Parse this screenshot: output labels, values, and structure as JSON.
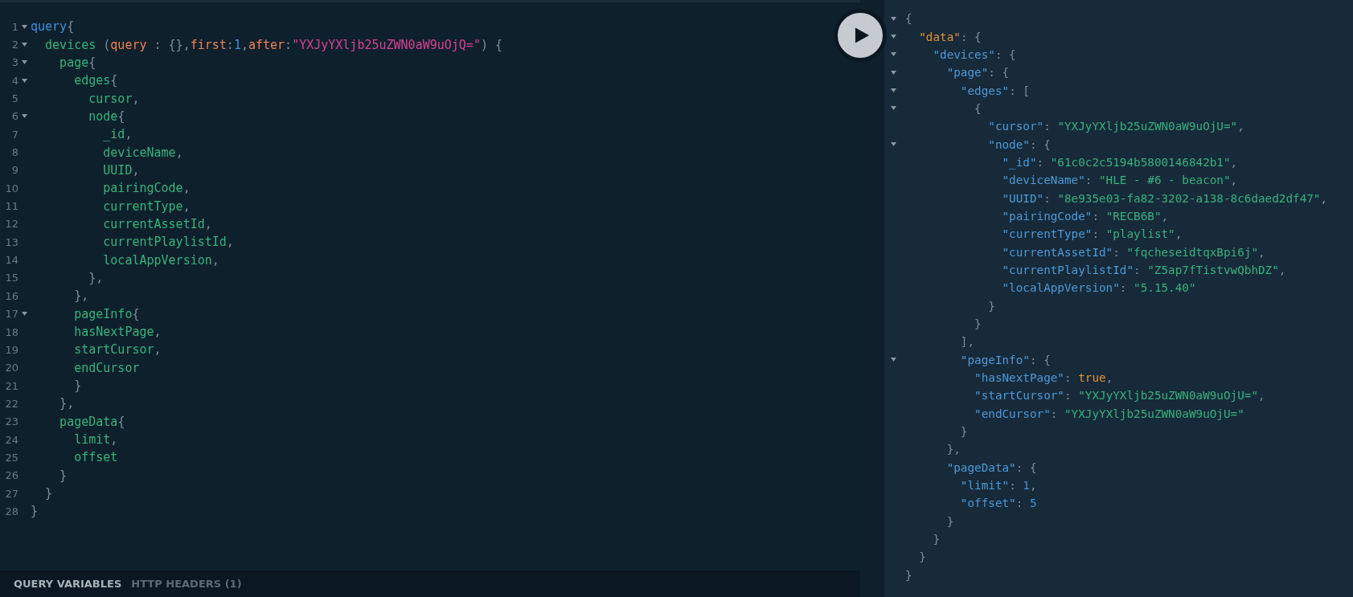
{
  "query_editor": {
    "lines": [
      {
        "number": "1",
        "fold": true,
        "tokens": [
          {
            "text": "query",
            "kind": "keyword"
          },
          {
            "text": "{",
            "kind": "punct"
          }
        ]
      },
      {
        "number": "2",
        "fold": true,
        "tokens": [
          {
            "text": "  devices",
            "kind": "field"
          },
          {
            "text": " (",
            "kind": "punct"
          },
          {
            "text": "query",
            "kind": "arg"
          },
          {
            "text": " : {},",
            "kind": "punct"
          },
          {
            "text": "first",
            "kind": "arg"
          },
          {
            "text": ":",
            "kind": "punct"
          },
          {
            "text": "1",
            "kind": "number"
          },
          {
            "text": ",",
            "kind": "punct"
          },
          {
            "text": "after",
            "kind": "arg"
          },
          {
            "text": ":",
            "kind": "punct"
          },
          {
            "text": "\"YXJyYXljb25uZWN0aW9uOjQ=\"",
            "kind": "string"
          },
          {
            "text": ") {",
            "kind": "punct"
          }
        ]
      },
      {
        "number": "3",
        "fold": true,
        "tokens": [
          {
            "text": "    page",
            "kind": "field"
          },
          {
            "text": "{",
            "kind": "punct"
          }
        ]
      },
      {
        "number": "4",
        "fold": true,
        "tokens": [
          {
            "text": "      edges",
            "kind": "field"
          },
          {
            "text": "{",
            "kind": "punct"
          }
        ]
      },
      {
        "number": "5",
        "fold": false,
        "tokens": [
          {
            "text": "        cursor",
            "kind": "field"
          },
          {
            "text": ",",
            "kind": "punct"
          }
        ]
      },
      {
        "number": "6",
        "fold": true,
        "tokens": [
          {
            "text": "        node",
            "kind": "field"
          },
          {
            "text": "{",
            "kind": "punct"
          }
        ]
      },
      {
        "number": "7",
        "fold": false,
        "tokens": [
          {
            "text": "          _id",
            "kind": "field"
          },
          {
            "text": ",",
            "kind": "punct"
          }
        ]
      },
      {
        "number": "8",
        "fold": false,
        "tokens": [
          {
            "text": "          deviceName",
            "kind": "field"
          },
          {
            "text": ",",
            "kind": "punct"
          }
        ]
      },
      {
        "number": "9",
        "fold": false,
        "tokens": [
          {
            "text": "          UUID",
            "kind": "field"
          },
          {
            "text": ",",
            "kind": "punct"
          }
        ]
      },
      {
        "number": "10",
        "fold": false,
        "tokens": [
          {
            "text": "          pairingCode",
            "kind": "field"
          },
          {
            "text": ",",
            "kind": "punct"
          }
        ]
      },
      {
        "number": "11",
        "fold": false,
        "tokens": [
          {
            "text": "          currentType",
            "kind": "field"
          },
          {
            "text": ",",
            "kind": "punct"
          }
        ]
      },
      {
        "number": "12",
        "fold": false,
        "tokens": [
          {
            "text": "          currentAssetId",
            "kind": "field"
          },
          {
            "text": ",",
            "kind": "punct"
          }
        ]
      },
      {
        "number": "13",
        "fold": false,
        "tokens": [
          {
            "text": "          currentPlaylistId",
            "kind": "field"
          },
          {
            "text": ",",
            "kind": "punct"
          }
        ]
      },
      {
        "number": "14",
        "fold": false,
        "tokens": [
          {
            "text": "          localAppVersion",
            "kind": "field"
          },
          {
            "text": ",",
            "kind": "punct"
          }
        ]
      },
      {
        "number": "15",
        "fold": false,
        "tokens": [
          {
            "text": "        },",
            "kind": "punct"
          }
        ]
      },
      {
        "number": "16",
        "fold": false,
        "tokens": [
          {
            "text": "      },",
            "kind": "punct"
          }
        ]
      },
      {
        "number": "17",
        "fold": true,
        "tokens": [
          {
            "text": "      pageInfo",
            "kind": "field"
          },
          {
            "text": "{",
            "kind": "punct"
          }
        ]
      },
      {
        "number": "18",
        "fold": false,
        "tokens": [
          {
            "text": "      hasNextPage",
            "kind": "field"
          },
          {
            "text": ",",
            "kind": "punct"
          }
        ]
      },
      {
        "number": "19",
        "fold": false,
        "tokens": [
          {
            "text": "      startCursor",
            "kind": "field"
          },
          {
            "text": ",",
            "kind": "punct"
          }
        ]
      },
      {
        "number": "20",
        "fold": false,
        "tokens": [
          {
            "text": "      endCursor",
            "kind": "field"
          }
        ]
      },
      {
        "number": "21",
        "fold": false,
        "tokens": [
          {
            "text": "      }",
            "kind": "punct"
          }
        ]
      },
      {
        "number": "22",
        "fold": false,
        "tokens": [
          {
            "text": "    },",
            "kind": "punct"
          }
        ]
      },
      {
        "number": "23",
        "fold": false,
        "tokens": [
          {
            "text": "    pageData",
            "kind": "field"
          },
          {
            "text": "{",
            "kind": "punct"
          }
        ]
      },
      {
        "number": "24",
        "fold": false,
        "tokens": [
          {
            "text": "      limit",
            "kind": "field"
          },
          {
            "text": ",",
            "kind": "punct"
          }
        ]
      },
      {
        "number": "25",
        "fold": false,
        "tokens": [
          {
            "text": "      offset",
            "kind": "field"
          }
        ]
      },
      {
        "number": "26",
        "fold": false,
        "tokens": [
          {
            "text": "    }",
            "kind": "punct"
          }
        ]
      },
      {
        "number": "27",
        "fold": false,
        "tokens": [
          {
            "text": "  }",
            "kind": "punct"
          }
        ]
      },
      {
        "number": "28",
        "fold": false,
        "tokens": [
          {
            "text": "}",
            "kind": "punct"
          }
        ]
      }
    ]
  },
  "bottom_tabs": [
    {
      "label": "QUERY VARIABLES",
      "selected": true
    },
    {
      "label": "HTTP HEADERS (1)",
      "selected": false
    }
  ],
  "result_viewer": {
    "lines": [
      {
        "fold": true,
        "tokens": [
          {
            "text": "{",
            "kind": "punct"
          }
        ]
      },
      {
        "fold": true,
        "tokens": [
          {
            "text": "  \"data\"",
            "kind": "root-key"
          },
          {
            "text": ": {",
            "kind": "punct"
          }
        ]
      },
      {
        "fold": true,
        "tokens": [
          {
            "text": "    \"devices\"",
            "kind": "key"
          },
          {
            "text": ": {",
            "kind": "punct"
          }
        ]
      },
      {
        "fold": true,
        "tokens": [
          {
            "text": "      \"page\"",
            "kind": "key"
          },
          {
            "text": ": {",
            "kind": "punct"
          }
        ]
      },
      {
        "fold": true,
        "tokens": [
          {
            "text": "        \"edges\"",
            "kind": "key"
          },
          {
            "text": ": [",
            "kind": "punct"
          }
        ]
      },
      {
        "fold": true,
        "tokens": [
          {
            "text": "          {",
            "kind": "punct"
          }
        ]
      },
      {
        "fold": false,
        "tokens": [
          {
            "text": "            \"cursor\"",
            "kind": "key"
          },
          {
            "text": ": ",
            "kind": "punct"
          },
          {
            "text": "\"YXJyYXljb25uZWN0aW9uOjU=\"",
            "kind": "string"
          },
          {
            "text": ",",
            "kind": "punct"
          }
        ]
      },
      {
        "fold": true,
        "tokens": [
          {
            "text": "            \"node\"",
            "kind": "key"
          },
          {
            "text": ": {",
            "kind": "punct"
          }
        ]
      },
      {
        "fold": false,
        "tokens": [
          {
            "text": "              \"_id\"",
            "kind": "key"
          },
          {
            "text": ": ",
            "kind": "punct"
          },
          {
            "text": "\"61c0c2c5194b5800146842b1\"",
            "kind": "string"
          },
          {
            "text": ",",
            "kind": "punct"
          }
        ]
      },
      {
        "fold": false,
        "tokens": [
          {
            "text": "              \"deviceName\"",
            "kind": "key"
          },
          {
            "text": ": ",
            "kind": "punct"
          },
          {
            "text": "\"HLE - #6 - beacon\"",
            "kind": "string"
          },
          {
            "text": ",",
            "kind": "punct"
          }
        ]
      },
      {
        "fold": false,
        "tokens": [
          {
            "text": "              \"UUID\"",
            "kind": "key"
          },
          {
            "text": ": ",
            "kind": "punct"
          },
          {
            "text": "\"8e935e03-fa82-3202-a138-8c6daed2df47\"",
            "kind": "string"
          },
          {
            "text": ",",
            "kind": "punct"
          }
        ]
      },
      {
        "fold": false,
        "tokens": [
          {
            "text": "              \"pairingCode\"",
            "kind": "key"
          },
          {
            "text": ": ",
            "kind": "punct"
          },
          {
            "text": "\"RECB6B\"",
            "kind": "string"
          },
          {
            "text": ",",
            "kind": "punct"
          }
        ]
      },
      {
        "fold": false,
        "tokens": [
          {
            "text": "              \"currentType\"",
            "kind": "key"
          },
          {
            "text": ": ",
            "kind": "punct"
          },
          {
            "text": "\"playlist\"",
            "kind": "string"
          },
          {
            "text": ",",
            "kind": "punct"
          }
        ]
      },
      {
        "fold": false,
        "tokens": [
          {
            "text": "              \"currentAssetId\"",
            "kind": "key"
          },
          {
            "text": ": ",
            "kind": "punct"
          },
          {
            "text": "\"fqcheseidtqxBpi6j\"",
            "kind": "string"
          },
          {
            "text": ",",
            "kind": "punct"
          }
        ]
      },
      {
        "fold": false,
        "tokens": [
          {
            "text": "              \"currentPlaylistId\"",
            "kind": "key"
          },
          {
            "text": ": ",
            "kind": "punct"
          },
          {
            "text": "\"Z5ap7fTistvwQbhDZ\"",
            "kind": "string"
          },
          {
            "text": ",",
            "kind": "punct"
          }
        ]
      },
      {
        "fold": false,
        "tokens": [
          {
            "text": "              \"localAppVersion\"",
            "kind": "key"
          },
          {
            "text": ": ",
            "kind": "punct"
          },
          {
            "text": "\"5.15.40\"",
            "kind": "string"
          }
        ]
      },
      {
        "fold": false,
        "tokens": [
          {
            "text": "            }",
            "kind": "punct"
          }
        ]
      },
      {
        "fold": false,
        "tokens": [
          {
            "text": "          }",
            "kind": "punct"
          }
        ]
      },
      {
        "fold": false,
        "tokens": [
          {
            "text": "        ],",
            "kind": "punct"
          }
        ]
      },
      {
        "fold": true,
        "tokens": [
          {
            "text": "        \"pageInfo\"",
            "kind": "key"
          },
          {
            "text": ": {",
            "kind": "punct"
          }
        ]
      },
      {
        "fold": false,
        "tokens": [
          {
            "text": "          \"hasNextPage\"",
            "kind": "key"
          },
          {
            "text": ": ",
            "kind": "punct"
          },
          {
            "text": "true",
            "kind": "bool"
          },
          {
            "text": ",",
            "kind": "punct"
          }
        ]
      },
      {
        "fold": false,
        "tokens": [
          {
            "text": "          \"startCursor\"",
            "kind": "key"
          },
          {
            "text": ": ",
            "kind": "punct"
          },
          {
            "text": "\"YXJyYXljb25uZWN0aW9uOjU=\"",
            "kind": "string"
          },
          {
            "text": ",",
            "kind": "punct"
          }
        ]
      },
      {
        "fold": false,
        "tokens": [
          {
            "text": "          \"endCursor\"",
            "kind": "key"
          },
          {
            "text": ": ",
            "kind": "punct"
          },
          {
            "text": "\"YXJyYXljb25uZWN0aW9uOjU=\"",
            "kind": "string"
          }
        ]
      },
      {
        "fold": false,
        "tokens": [
          {
            "text": "        }",
            "kind": "punct"
          }
        ]
      },
      {
        "fold": false,
        "tokens": [
          {
            "text": "      },",
            "kind": "punct"
          }
        ]
      },
      {
        "fold": false,
        "tokens": [
          {
            "text": "      \"pageData\"",
            "kind": "key"
          },
          {
            "text": ": {",
            "kind": "punct"
          }
        ]
      },
      {
        "fold": false,
        "tokens": [
          {
            "text": "        \"limit\"",
            "kind": "key"
          },
          {
            "text": ": ",
            "kind": "punct"
          },
          {
            "text": "1",
            "kind": "number"
          },
          {
            "text": ",",
            "kind": "punct"
          }
        ]
      },
      {
        "fold": false,
        "tokens": [
          {
            "text": "        \"offset\"",
            "kind": "key"
          },
          {
            "text": ": ",
            "kind": "punct"
          },
          {
            "text": "5",
            "kind": "number"
          }
        ]
      },
      {
        "fold": false,
        "tokens": [
          {
            "text": "      }",
            "kind": "punct"
          }
        ]
      },
      {
        "fold": false,
        "tokens": [
          {
            "text": "    }",
            "kind": "punct"
          }
        ]
      },
      {
        "fold": false,
        "tokens": [
          {
            "text": "  }",
            "kind": "punct"
          }
        ]
      },
      {
        "fold": false,
        "tokens": [
          {
            "text": "}",
            "kind": "punct"
          }
        ]
      }
    ]
  }
}
